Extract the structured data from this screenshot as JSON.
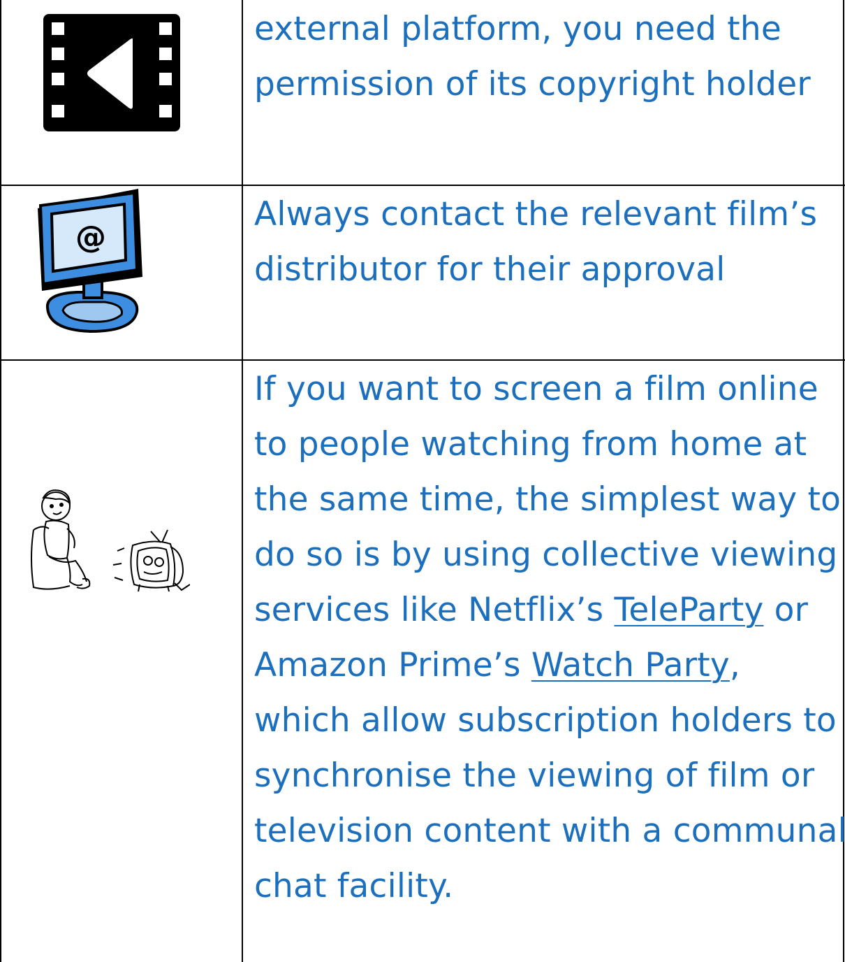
{
  "rows": [
    {
      "icon": "film-strip-play-icon",
      "lines": [
        "external platform, you need the",
        "permission of its copyright holder"
      ]
    },
    {
      "icon": "computer-monitor-email-icon",
      "lines": [
        "Always contact the relevant film’s",
        "distributor for their approval"
      ]
    },
    {
      "icon": "person-watching-tv-icon",
      "line1": "If you want to screen a film online",
      "line2": "to people watching from home at",
      "line3": "the same time, the simplest way to",
      "line4": "do so is by using collective viewing",
      "line5_prefix": "services like Netflix’s ",
      "line5_link": "TeleParty",
      "line5_suffix": " or",
      "line6_prefix": "Amazon Prime’s ",
      "line6_link": "Watch Party",
      "line6_suffix": ",",
      "line7": "which allow subscription holders to",
      "line8": "synchronise the viewing of film or",
      "line9": "television content with a communal",
      "line10": "chat facility."
    }
  ],
  "colors": {
    "text": "#1b6fbd",
    "border": "#000000",
    "monitor_blue": "#3d8ee0"
  }
}
